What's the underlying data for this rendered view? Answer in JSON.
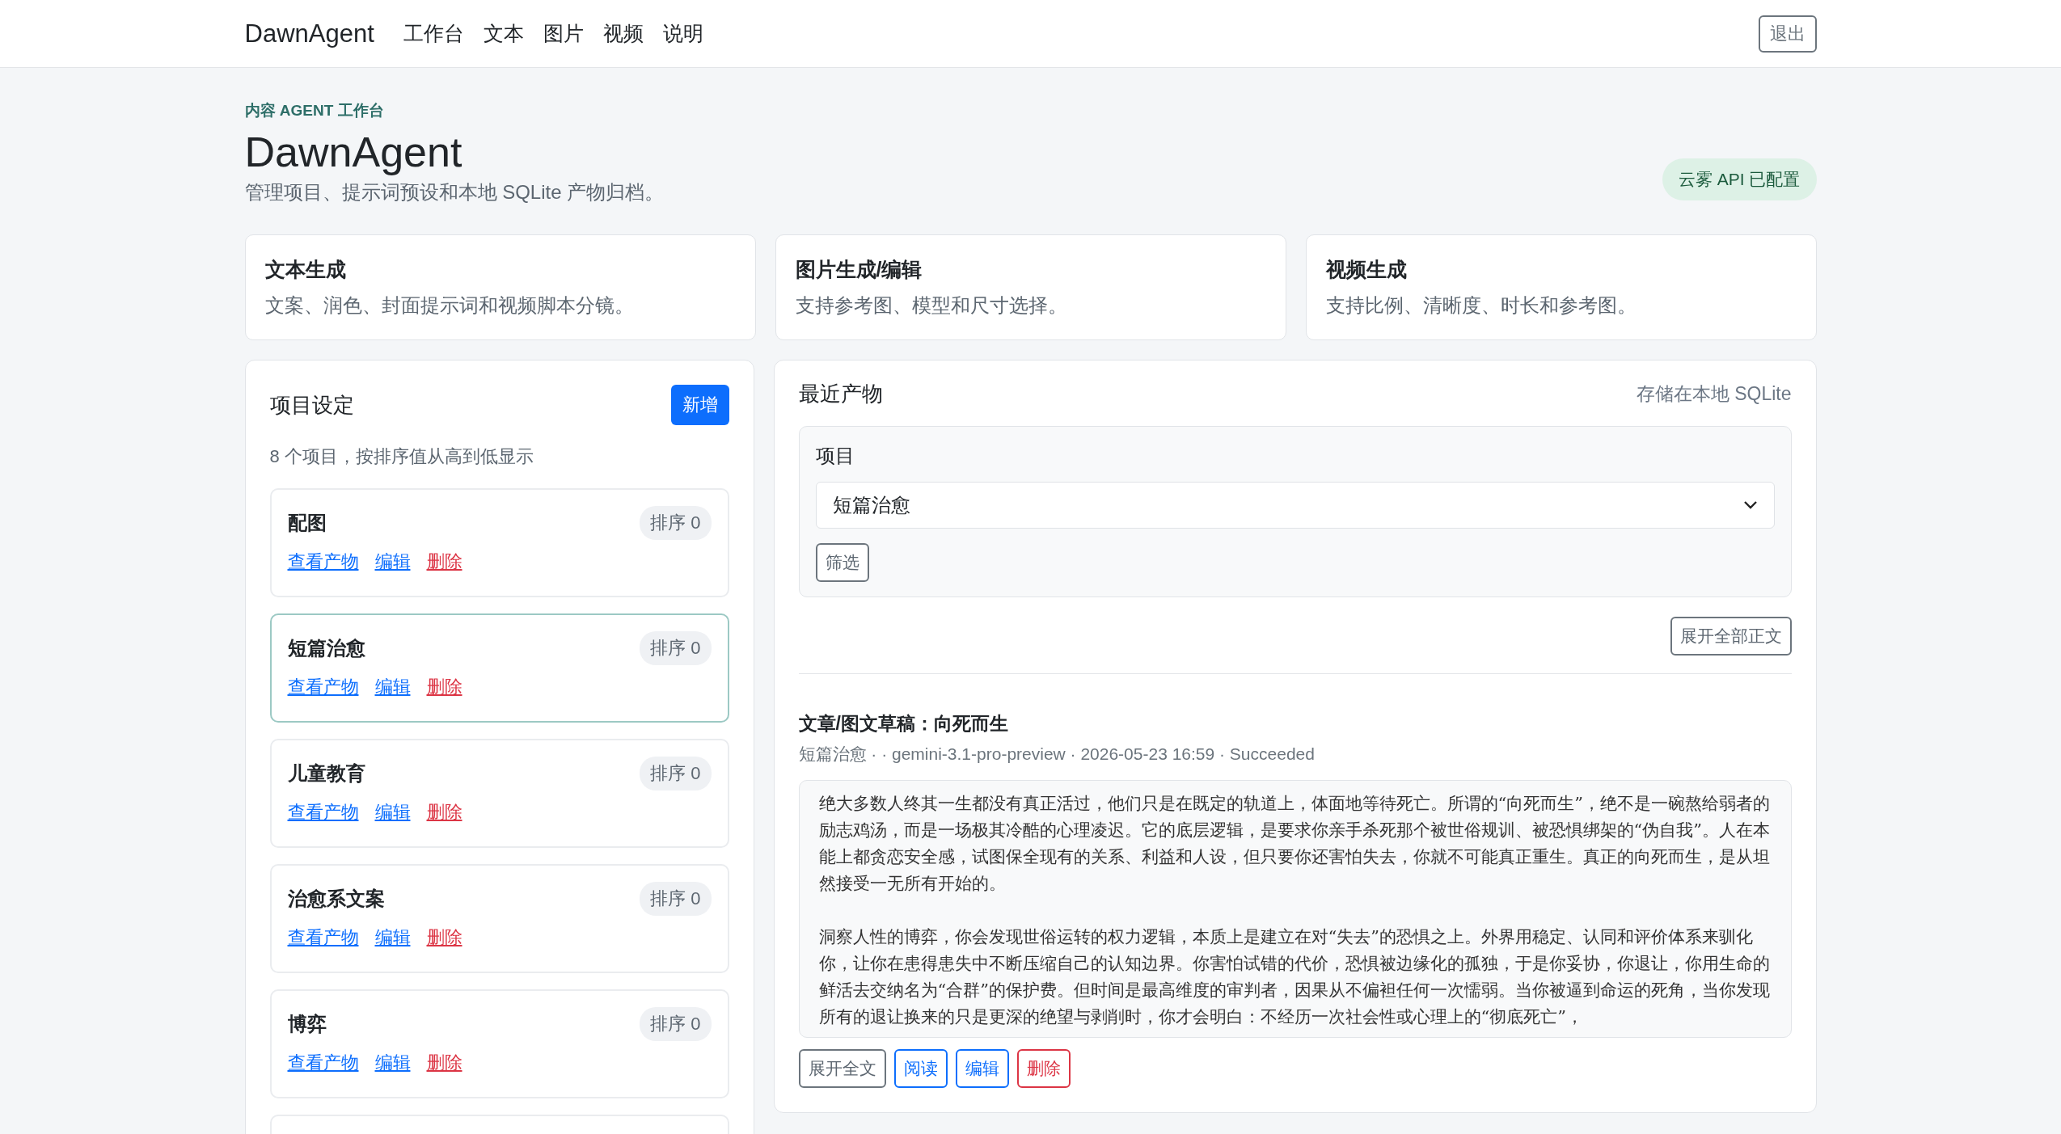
{
  "nav": {
    "brand": "DawnAgent",
    "links": [
      "工作台",
      "文本",
      "图片",
      "视频",
      "说明"
    ],
    "logout": "退出"
  },
  "hero": {
    "eyebrow": "内容 AGENT 工作台",
    "title": "DawnAgent",
    "subtitle": "管理项目、提示词预设和本地 SQLite 产物归档。",
    "status_badge": "云雾 API 已配置"
  },
  "features": [
    {
      "title": "文本生成",
      "description": "文案、润色、封面提示词和视频脚本分镜。"
    },
    {
      "title": "图片生成/编辑",
      "description": "支持参考图、模型和尺寸选择。"
    },
    {
      "title": "视频生成",
      "description": "支持比例、清晰度、时长和参考图。"
    }
  ],
  "projects": {
    "title": "项目设定",
    "add_button": "新增",
    "summary": "8 个项目，按排序值从高到低显示",
    "items": [
      {
        "name": "配图",
        "selected": false,
        "sort_badge": "排序 0",
        "actions": [
          {
            "label": "查看产物",
            "kind": "link"
          },
          {
            "label": "编辑",
            "kind": "link"
          },
          {
            "label": "删除",
            "kind": "danger"
          }
        ]
      },
      {
        "name": "短篇治愈",
        "selected": true,
        "sort_badge": "排序 0",
        "actions": [
          {
            "label": "查看产物",
            "kind": "link"
          },
          {
            "label": "编辑",
            "kind": "link"
          },
          {
            "label": "删除",
            "kind": "danger"
          }
        ]
      },
      {
        "name": "儿童教育",
        "selected": false,
        "sort_badge": "排序 0",
        "actions": [
          {
            "label": "查看产物",
            "kind": "link"
          },
          {
            "label": "编辑",
            "kind": "link"
          },
          {
            "label": "删除",
            "kind": "danger"
          }
        ]
      },
      {
        "name": "治愈系文案",
        "selected": false,
        "sort_badge": "排序 0",
        "actions": [
          {
            "label": "查看产物",
            "kind": "link"
          },
          {
            "label": "编辑",
            "kind": "link"
          },
          {
            "label": "删除",
            "kind": "danger"
          }
        ]
      },
      {
        "name": "博弈",
        "selected": false,
        "sort_badge": "排序 0",
        "actions": [
          {
            "label": "查看产物",
            "kind": "link"
          },
          {
            "label": "编辑",
            "kind": "link"
          },
          {
            "label": "删除",
            "kind": "danger"
          }
        ]
      }
    ]
  },
  "artifacts": {
    "title": "最近产物",
    "storage_note": "存储在本地 SQLite",
    "filter": {
      "label": "项目",
      "value": "短篇治愈",
      "button": "筛选"
    },
    "expand_all_button": "展开全部正文",
    "items": [
      {
        "title": "文章/图文草稿：向死而生",
        "meta": "短篇治愈 · · gemini-3.1-pro-preview · 2026-05-23 16:59 · Succeeded",
        "paragraphs": [
          "绝大多数人终其一生都没有真正活过，他们只是在既定的轨道上，体面地等待死亡。所谓的“向死而生”，绝不是一碗熬给弱者的励志鸡汤，而是一场极其冷酷的心理凌迟。它的底层逻辑，是要求你亲手杀死那个被世俗规训、被恐惧绑架的“伪自我”。人在本能上都贪恋安全感，试图保全现有的关系、利益和人设，但只要你还害怕失去，你就不可能真正重生。真正的向死而生，是从坦然接受一无所有开始的。",
          "洞察人性的博弈，你会发现世俗运转的权力逻辑，本质上是建立在对“失去”的恐惧之上。外界用稳定、认同和评价体系来驯化你，让你在患得患失中不断压缩自己的认知边界。你害怕试错的代价，恐惧被边缘化的孤独，于是你妥协，你退让，你用生命的鲜活去交纳名为“合群”的保护费。但时间是最高维度的审判者，因果从不偏袒任何一次懦弱。当你被逼到命运的死角，当你发现所有的退让换来的只是更深的绝望与剥削时，你才会明白：不经历一次社会性或心理上的“彻底死亡”，"
        ],
        "buttons": [
          {
            "label": "展开全文",
            "kind": "secondary"
          },
          {
            "label": "阅读",
            "kind": "primary"
          },
          {
            "label": "编辑",
            "kind": "primary"
          },
          {
            "label": "删除",
            "kind": "danger"
          }
        ]
      }
    ]
  }
}
